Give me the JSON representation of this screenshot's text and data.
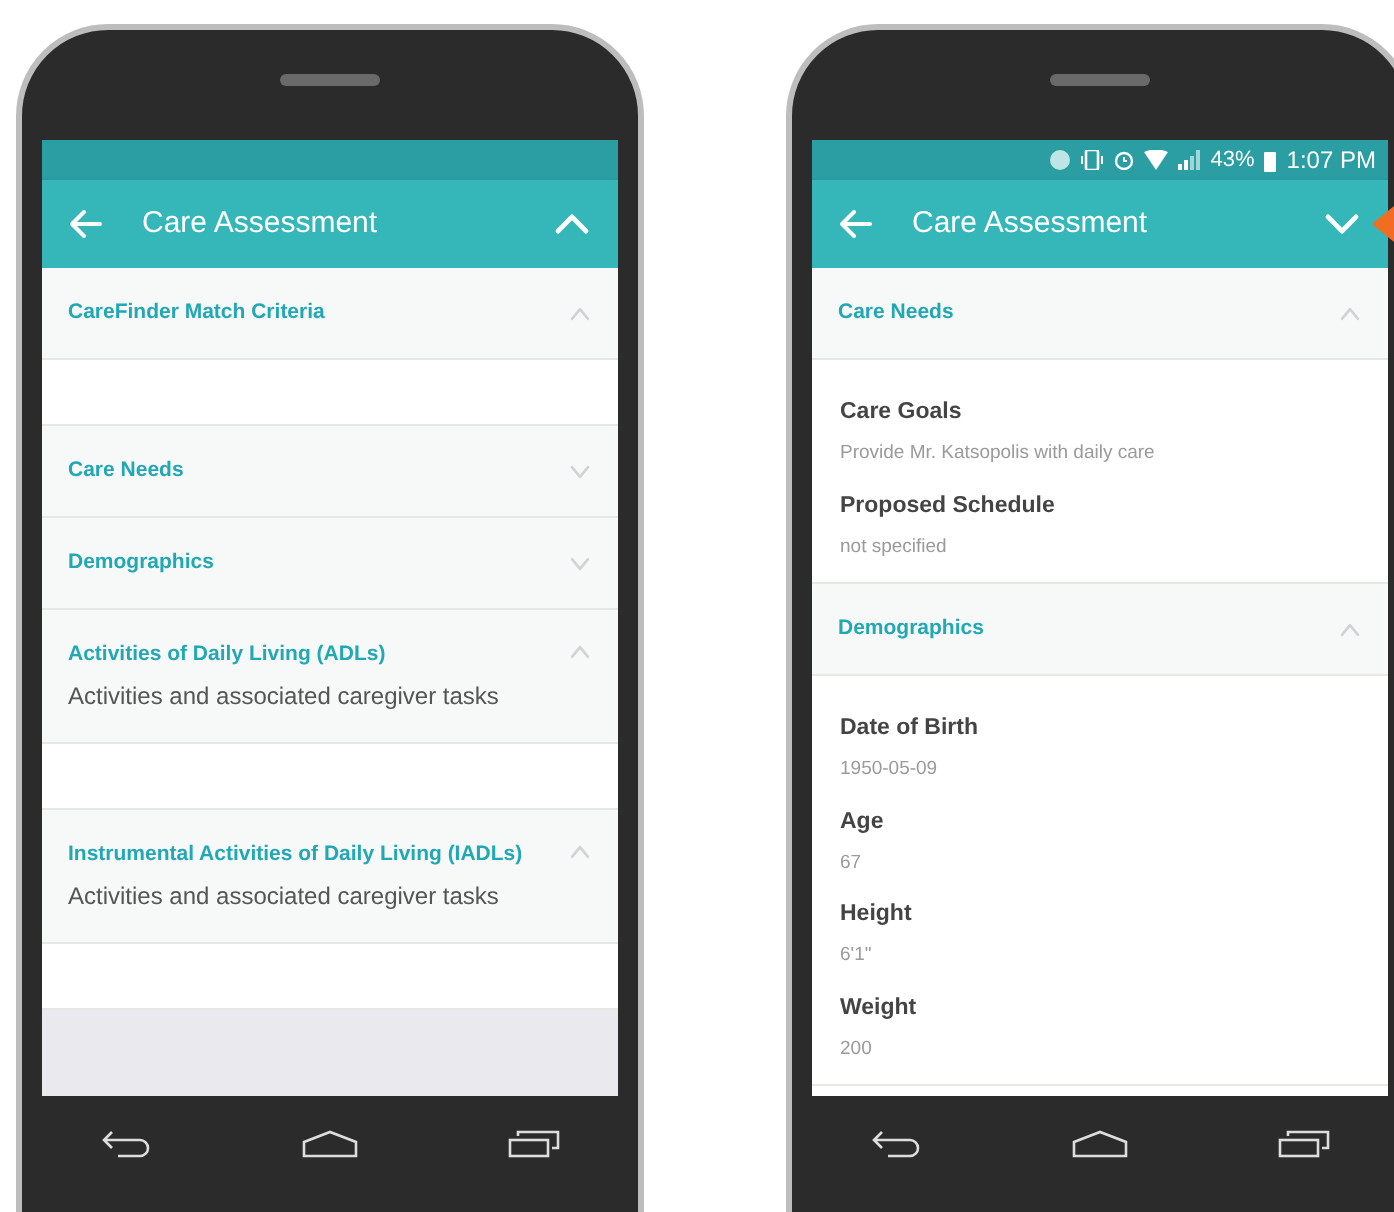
{
  "phones": [
    {
      "app_bar": {
        "title": "Care Assessment",
        "expanded": true
      },
      "sections": [
        {
          "title": "CareFinder Match Criteria",
          "expanded": true
        },
        {
          "title": "Care Needs",
          "expanded": false
        },
        {
          "title": "Demographics",
          "expanded": false
        },
        {
          "title": "Activities of Daily Living (ADLs)",
          "subtitle": "Activities and associated caregiver tasks",
          "expanded": true
        },
        {
          "title": "Instrumental Activities of Daily Living (IADLs)",
          "subtitle": "Activities and associated caregiver tasks",
          "expanded": true
        }
      ]
    },
    {
      "status_bar": {
        "battery": "43%",
        "time": "1:07 PM"
      },
      "app_bar": {
        "title": "Care Assessment",
        "expanded": false
      },
      "sections": [
        {
          "title": "Care Needs",
          "expanded": true,
          "fields": [
            {
              "label": "Care Goals",
              "value": "Provide Mr. Katsopolis with daily care"
            },
            {
              "label": "Proposed Schedule",
              "value": "not specified"
            }
          ]
        },
        {
          "title": "Demographics",
          "expanded": true,
          "fields": [
            {
              "label": "Date of Birth",
              "value": "1950-05-09"
            },
            {
              "label": "Age",
              "value": "67"
            },
            {
              "label": "Height",
              "value": "6'1\""
            },
            {
              "label": "Weight",
              "value": "200"
            }
          ]
        }
      ]
    }
  ]
}
